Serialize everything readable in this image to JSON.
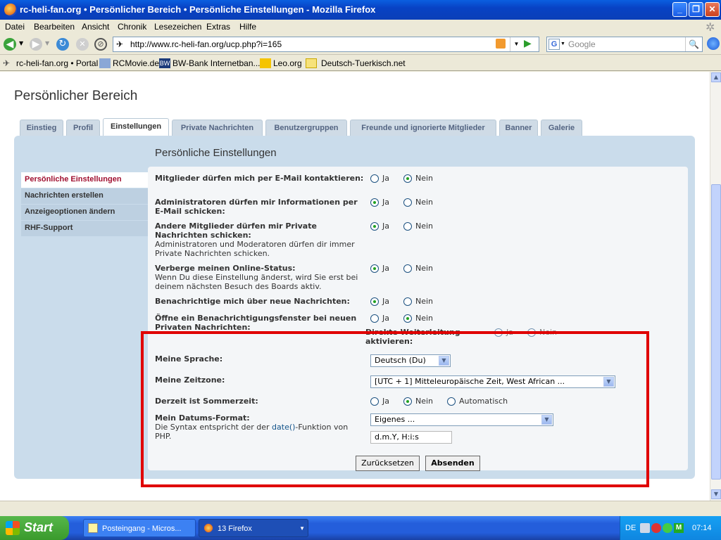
{
  "window": {
    "title": "rc-heli-fan.org • Persönlicher Bereich • Persönliche Einstellungen - Mozilla Firefox"
  },
  "menu": [
    "Datei",
    "Bearbeiten",
    "Ansicht",
    "Chronik",
    "Lesezeichen",
    "Extras",
    "Hilfe"
  ],
  "url": "http://www.rc-heli-fan.org/ucp.php?i=165",
  "search_placeholder": "Google",
  "bookmarks": [
    "rc-heli-fan.org • Portal",
    "RCMovie.de",
    "BW-Bank Internetban...",
    "Leo.org",
    "Deutsch-Tuerkisch.net"
  ],
  "page": {
    "title": "Persönlicher Bereich",
    "tabs": [
      "Einstieg",
      "Profil",
      "Einstellungen",
      "Private Nachrichten",
      "Benutzergruppen",
      "Freunde und ignorierte Mitglieder",
      "Banner",
      "Galerie"
    ],
    "section_title": "Persönliche Einstellungen",
    "left_nav": [
      "Persönliche Einstellungen",
      "Nachrichten erstellen",
      "Anzeigeoptionen ändern",
      "RHF-Support"
    ],
    "yes": "Ja",
    "no": "Nein",
    "auto": "Automatisch",
    "rows": {
      "r1": "Mitglieder dürfen mich per E-Mail kontaktieren:",
      "r2": "Administratoren dürfen mir Informationen per E-Mail schicken:",
      "r3": "Andere Mitglieder dürfen mir Private Nachrichten schicken:",
      "r3_desc": "Administratoren und Moderatoren dürfen dir immer Private Nachrichten schicken.",
      "r4": "Verberge meinen Online-Status:",
      "r4_desc": "Wenn Du diese Einstellung änderst, wird Sie erst bei deinem nächsten Besuch des Boards aktiv.",
      "r5": "Benachrichtige mich über neue Nachrichten:",
      "r6": "Öffne ein Benachrichtigungsfenster bei neuen Privaten Nachrichten:",
      "r7": "Direkte Weiterleitung aktivieren:",
      "language_label": "Meine Sprache:",
      "language_value": "Deutsch (Du)",
      "timezone_label": "Meine Zeitzone:",
      "timezone_value": "[UTC + 1] Mitteleuropäische Zeit, West African ...",
      "dst_label": "Derzeit ist Sommerzeit:",
      "dateformat_label": "Mein Datums-Format:",
      "dateformat_desc_pre": "Die Syntax entspricht der der ",
      "dateformat_link": "date()",
      "dateformat_desc_post": "-Funktion von PHP.",
      "dateformat_select": "Eigenes ...",
      "dateformat_value": "d.m.Y, H:i:s"
    },
    "reset_button": "Zurücksetzen",
    "submit_button": "Absenden"
  },
  "taskbar": {
    "start": "Start",
    "tasks": [
      "Posteingang - Micros...",
      "13 Firefox"
    ],
    "lang": "DE",
    "clock": "07:14"
  }
}
